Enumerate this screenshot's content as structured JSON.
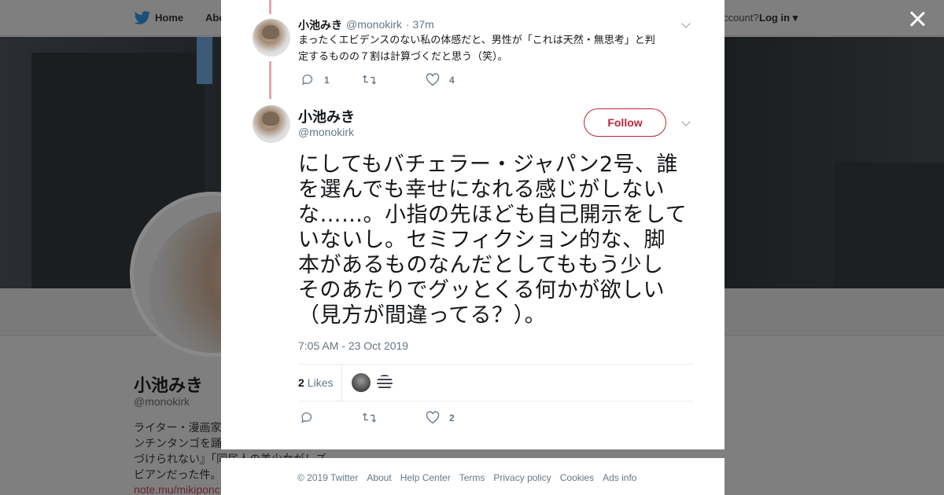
{
  "topbar": {
    "home_label": "Home",
    "about_label": "Abo",
    "account_prompt": "ccount?",
    "login_label": "Log in"
  },
  "profile_bg": {
    "name": "小池みき",
    "handle": "@monokirk",
    "bio_lines": [
      "ライター・漫画家",
      "ンチンタンゴを踊",
      "づけられない』「同居人の美少女がレズ",
      "ビアンだった件。"
    ],
    "link": "note.mu/mikiponc"
  },
  "reply_tweet": {
    "name": "小池みき",
    "handle": "@monokirk",
    "time": "· 37m",
    "text_line1": "まったくエビデンスのない私の体感だと、男性が「これは天然・無思考」と判",
    "text_line2": "定するものの７割は計算づくだと思う（笑）。",
    "reply_count": "1",
    "retweet_count": "",
    "like_count": "4"
  },
  "main_tweet": {
    "name": "小池みき",
    "handle": "@monokirk",
    "follow_label": "Follow",
    "text_lines": [
      "にしてもバチェラー・ジャパン2号、誰",
      "を選んでも幸せになれる感じがしない",
      "な……。小指の先ほども自己開示をして",
      "いないし。セミフィクション的な、脚",
      "本があるものなんだとしてももう少し",
      "そのあたりでグッとくる何かが欲しい",
      "（見方が間違ってる？）。"
    ],
    "timestamp": "7:05 AM - 23 Oct 2019",
    "likes_count": "2",
    "likes_label": "Likes",
    "action_like_count": "2"
  },
  "footer": {
    "links": [
      "© 2019 Twitter",
      "About",
      "Help Center",
      "Terms",
      "Privacy policy",
      "Cookies",
      "Ads info"
    ]
  },
  "colors": {
    "accent": "#b8283a",
    "thread_line": "#e4a6ae",
    "muted": "#657786"
  }
}
